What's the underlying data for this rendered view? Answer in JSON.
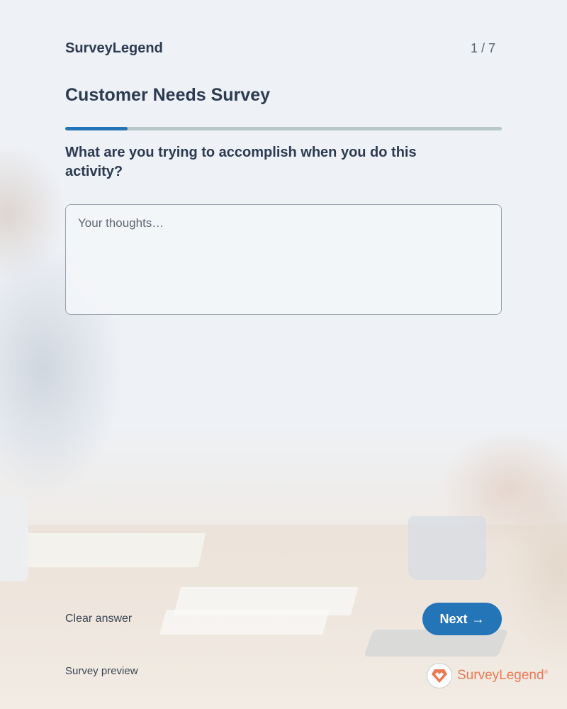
{
  "header": {
    "brand": "SurveyLegend",
    "page_counter": "1 / 7"
  },
  "survey": {
    "title": "Customer Needs Survey",
    "progress": {
      "current": 1,
      "total": 7
    }
  },
  "question": {
    "text": "What are you trying to accomplish when you do this activity?",
    "answer_value": "",
    "answer_placeholder": "Your thoughts…"
  },
  "actions": {
    "clear_label": "Clear answer",
    "next_label": "Next",
    "next_arrow": "→"
  },
  "footer": {
    "note": "Survey preview",
    "logo_text": "SurveyLegend",
    "logo_mark": "®"
  },
  "colors": {
    "accent": "#2474b8",
    "title_text": "#2c3b50",
    "logo_orange": "#ea7a55",
    "progress_track": "#b8c8c8"
  },
  "icons": {
    "logo_badge": "surveylegend-heart-logo-icon",
    "next": "arrow-right-icon"
  }
}
